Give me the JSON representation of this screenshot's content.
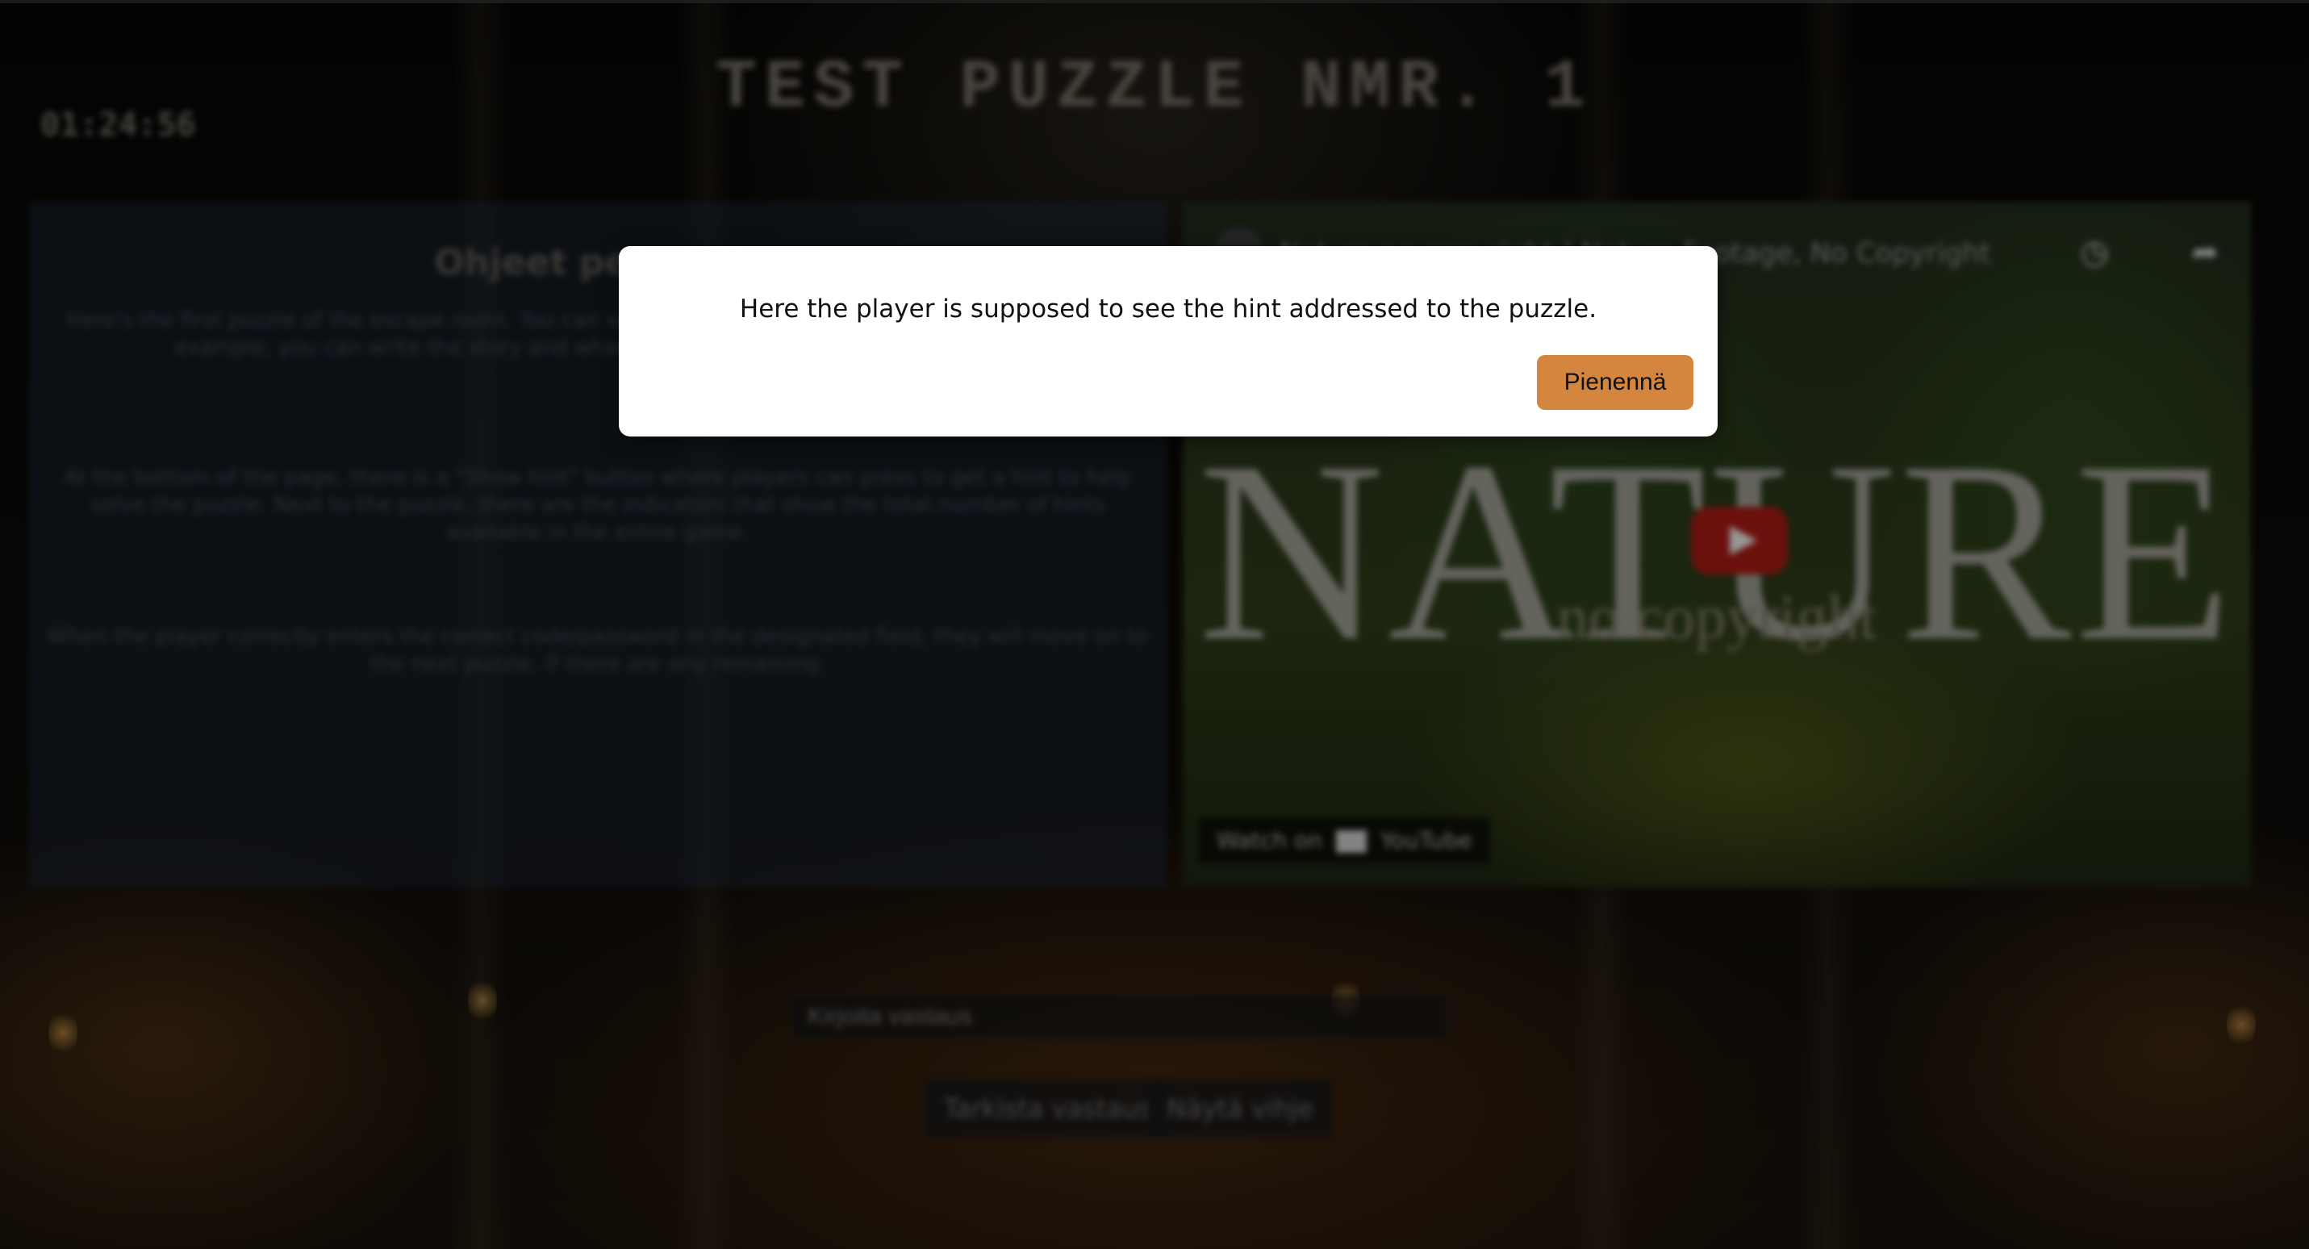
{
  "game": {
    "timer": "01:24:56",
    "title": "TEST PUZZLE NMR. 1"
  },
  "instructions": {
    "heading": "Ohjeet pelaajille",
    "paragraphs": [
      "Here's the first puzzle of the escape room. You can write a description of the puzzle to the player. For example, you can write the story and what the player needs to solve the puzzle.",
      "At the bottom of the page, there is a \"Show hint\" button where players can press to get a hint to help solve the puzzle. Next to the puzzle, there are the indicators that show the total number of hints available in the entire game.",
      "When the player correctly enters the correct code/password in the designated field, they will move on to the next puzzle. If there are any remaining."
    ]
  },
  "video": {
    "channel_title": "Nature no copyright | Nature Footage, No Copyright",
    "big_text": "NATURE",
    "sub_text": "no copyright",
    "watch_on": "Watch on",
    "platform": "YouTube",
    "icons": [
      "clock-icon",
      "share-icon"
    ]
  },
  "answer": {
    "placeholder": "Kirjoita vastaus"
  },
  "buttons": {
    "submit": "Tarkista vastaus",
    "hint": "Näytä vihje"
  },
  "modal": {
    "hint_text": "Here the player is supposed to see the hint addressed to the puzzle.",
    "close_label": "Pienennä",
    "accent": "#d4853e"
  }
}
